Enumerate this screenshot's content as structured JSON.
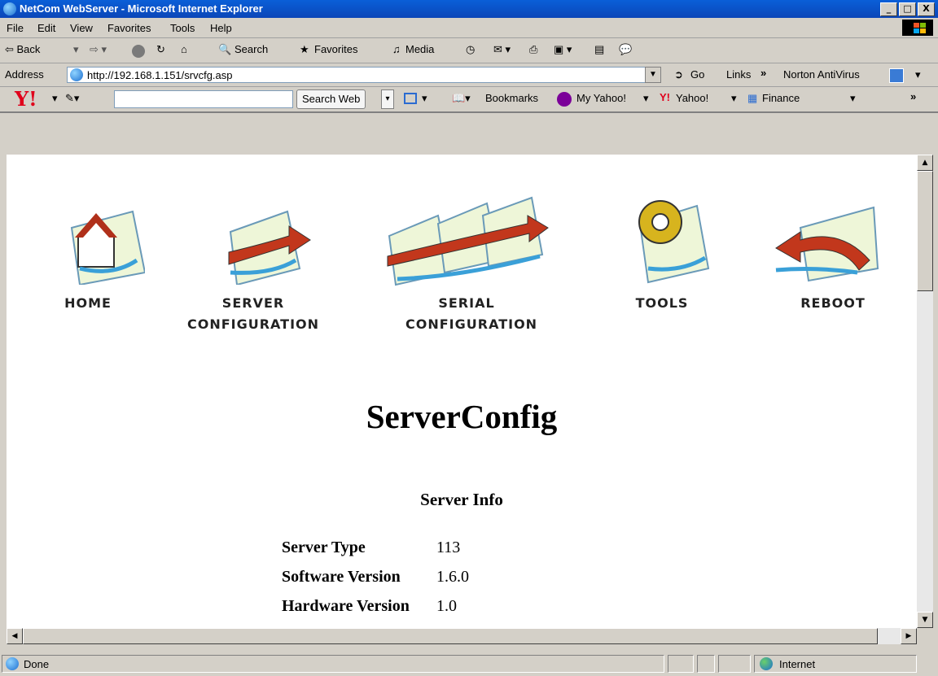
{
  "window": {
    "title": "NetCom WebServer - Microsoft Internet Explorer",
    "controls": [
      "_",
      "□",
      "X"
    ]
  },
  "menu": [
    "File",
    "Edit",
    "View",
    "Favorites",
    "Tools",
    "Help"
  ],
  "toolbar": {
    "back": "⇦ Back",
    "search": "Search",
    "favorites": "Favorites",
    "media": "Media"
  },
  "address": {
    "label": "Address",
    "url": "http://192.168.1.151/srvcfg.asp",
    "go": "Go",
    "links": "Links",
    "norton": "Norton AntiVirus"
  },
  "yahoo_bar": {
    "logo": "Y!",
    "search_button": "Search Web",
    "bookmarks": "Bookmarks",
    "my_yahoo": "My Yahoo!",
    "yahoo": "Yahoo!",
    "finance": "Finance"
  },
  "nav": {
    "home": "HOME",
    "server_line1": "SERVER",
    "server_line2": "CONFIGURATION",
    "serial_line1": "SERIAL",
    "serial_line2": "CONFIGURATION",
    "tools": "TOOLS",
    "reboot": "REBOOT"
  },
  "page": {
    "heading": "ServerConfig",
    "subheading": "Server Info",
    "info_rows": [
      {
        "label": "Server Type",
        "value": "113"
      },
      {
        "label": "Software Version",
        "value": "1.6.0"
      },
      {
        "label": "Hardware Version",
        "value": "1.0"
      }
    ]
  },
  "status": {
    "text": "Done",
    "zone": "Internet"
  }
}
